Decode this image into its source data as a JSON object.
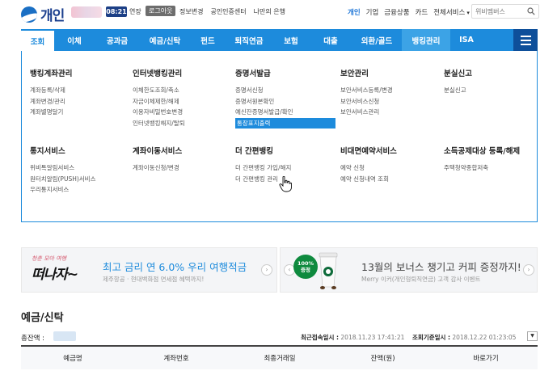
{
  "header": {
    "logo_text": "개인",
    "session_timer": "08:21",
    "extend_label": "연장",
    "logout_label": "로그아웃",
    "links": [
      "정보변경",
      "공인인증센터",
      "나만의 은행"
    ],
    "right_links": [
      "개인",
      "기업",
      "금융상품",
      "카드",
      "전체서비스"
    ],
    "search_placeholder": "위비멤버스"
  },
  "nav": {
    "items": [
      "조회",
      "이체",
      "공과금",
      "예금/신탁",
      "펀드",
      "퇴직연금",
      "보험",
      "대출",
      "외환/골드",
      "뱅킹관리",
      "ISA"
    ],
    "active_index": 0,
    "open_index": 9
  },
  "mega_menu": {
    "columns": [
      {
        "title": "뱅킹계좌관리",
        "items": [
          "계좌등록/삭제",
          "계좌변경/관리",
          "계좌별명달기"
        ]
      },
      {
        "title": "인터넷뱅킹관리",
        "items": [
          "이체한도조회/축소",
          "자금이체제한/해제",
          "이용자비밀번호변경",
          "인터넷뱅킹해지/탈퇴"
        ]
      },
      {
        "title": "증명서발급",
        "items": [
          "증명서신청",
          "증명서원본확인",
          "예신잔증명서발급/확인",
          "통장표지출력"
        ],
        "highlight_index": 3
      },
      {
        "title": "보안관리",
        "items": [
          "보안서비스등록/변경",
          "보안서비스신청",
          "보안서비스관리"
        ]
      },
      {
        "title": "분실신고",
        "items": [
          "분실신고"
        ]
      },
      {
        "title": "통지서비스",
        "items": [
          "위비톡알림서비스",
          "원터치알림(PUSH)서비스",
          "우리통지서비스"
        ]
      },
      {
        "title": "계좌이동서비스",
        "items": [
          "계좌이동신청/변경"
        ]
      },
      {
        "title": "더 간편뱅킹",
        "items": [
          "더 간편뱅킹 가입/해지",
          "더 간편뱅킹 관리"
        ]
      },
      {
        "title": "비대면예약서비스",
        "items": [
          "예약 신청",
          "예약 신청내역 조회"
        ]
      },
      {
        "title": "소득공제대상 등록/해제",
        "items": [
          "주택청약종합저축"
        ]
      }
    ]
  },
  "banners": {
    "left": {
      "art_small": "청춘 모아 여행",
      "art_big": "떠나자~",
      "title": "최고 금리 연 6.0% 우리 여행적금",
      "subtitle": "제주항공 · 현대백화점 면세점 혜택까지!"
    },
    "right": {
      "badge_line1": "100%",
      "badge_line2": "증정",
      "title": "13월의 보너스 챙기고 커피 증정까지!",
      "subtitle": "Merry 이커(개인형퇴직연금) 고객 감사 이벤트"
    }
  },
  "deposits": {
    "title": "예금/신탁",
    "balance_label": "총잔액 :",
    "last_login_label": "최근접속일시 :",
    "last_login_value": "2018.11.23 17:41:21",
    "query_time_label": "조회기준일시 :",
    "query_time_value": "2018.12.22 01:23:05",
    "columns": [
      "예금명",
      "계좌번호",
      "최종거래일",
      "잔액(원)",
      "바로가기"
    ]
  }
}
